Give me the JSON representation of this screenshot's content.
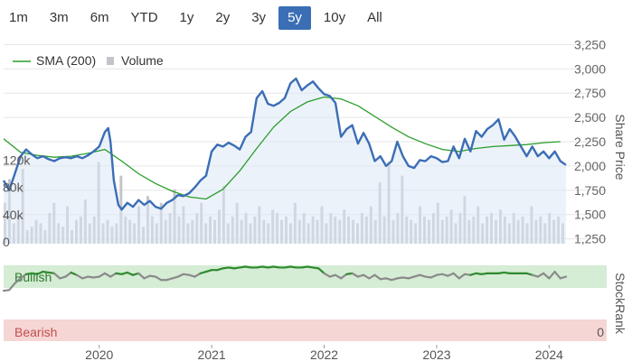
{
  "range_buttons": [
    "1m",
    "3m",
    "6m",
    "YTD",
    "1y",
    "2y",
    "3y",
    "5y",
    "10y",
    "All"
  ],
  "active_range": "5y",
  "colors": {
    "price_line": "#3b6eb5",
    "sma_line": "#2a9d2a",
    "volume_bar": "#c4c4c8",
    "stockrank_line_high": "#2f8a2f",
    "stockrank_line_low": "#8a8a8a",
    "bullish_band": "#d5ecd5",
    "bearish_band": "#f6d5d5",
    "active_button": "#3b6eb5"
  },
  "chart_data": [
    {
      "type": "line",
      "legend": [
        "SMA (200)",
        "Volume"
      ],
      "y_right_label": "Share Price",
      "y_right_ticks": [
        1250,
        1500,
        1750,
        2000,
        2250,
        2500,
        2750,
        3000,
        3250
      ],
      "y_right_tick_labels": [
        "1,250",
        "1,500",
        "1,750",
        "2,000",
        "2,250",
        "2,500",
        "2,750",
        "3,000",
        "3,250"
      ],
      "ylim": [
        1200,
        3300
      ],
      "volume_ticks_labels": [
        "0",
        "40k",
        "80k",
        "120k"
      ],
      "volume_ticks": [
        0,
        40,
        80,
        120
      ],
      "volume_ylim": [
        0,
        300
      ],
      "x_ticks": [
        "2020",
        "2021",
        "2022",
        "2023",
        "2024"
      ],
      "x_tick_values": [
        2020,
        2021,
        2022,
        2023,
        2024
      ],
      "xlim": [
        2019.15,
        2024.15
      ],
      "series": [
        {
          "name": "Share Price",
          "x": [
            2019.15,
            2019.2,
            2019.25,
            2019.3,
            2019.35,
            2019.4,
            2019.45,
            2019.5,
            2019.55,
            2019.6,
            2019.65,
            2019.7,
            2019.75,
            2019.8,
            2019.85,
            2019.9,
            2019.95,
            2020.0,
            2020.05,
            2020.08,
            2020.1,
            2020.13,
            2020.17,
            2020.2,
            2020.25,
            2020.3,
            2020.35,
            2020.4,
            2020.45,
            2020.5,
            2020.55,
            2020.6,
            2020.65,
            2020.7,
            2020.75,
            2020.8,
            2020.85,
            2020.9,
            2020.95,
            2021.0,
            2021.05,
            2021.1,
            2021.15,
            2021.2,
            2021.25,
            2021.3,
            2021.35,
            2021.4,
            2021.45,
            2021.5,
            2021.55,
            2021.6,
            2021.65,
            2021.7,
            2021.75,
            2021.8,
            2021.85,
            2021.9,
            2021.95,
            2022.0,
            2022.05,
            2022.1,
            2022.15,
            2022.2,
            2022.25,
            2022.3,
            2022.35,
            2022.4,
            2022.45,
            2022.5,
            2022.55,
            2022.6,
            2022.65,
            2022.7,
            2022.75,
            2022.8,
            2022.85,
            2022.9,
            2022.95,
            2023.0,
            2023.05,
            2023.1,
            2023.15,
            2023.2,
            2023.25,
            2023.3,
            2023.35,
            2023.4,
            2023.45,
            2023.5,
            2023.55,
            2023.6,
            2023.65,
            2023.7,
            2023.75,
            2023.8,
            2023.85,
            2023.9,
            2023.95,
            2024.0,
            2024.05,
            2024.1,
            2024.15
          ],
          "values": [
            1850,
            1750,
            1920,
            2100,
            2170,
            2120,
            2080,
            2100,
            2070,
            2050,
            2080,
            2090,
            2080,
            2100,
            2080,
            2110,
            2150,
            2200,
            2350,
            2390,
            2250,
            1850,
            1600,
            1550,
            1620,
            1580,
            1650,
            1600,
            1640,
            1580,
            1560,
            1620,
            1650,
            1700,
            1690,
            1720,
            1780,
            1850,
            1900,
            2150,
            2220,
            2200,
            2240,
            2210,
            2170,
            2300,
            2350,
            2700,
            2770,
            2640,
            2620,
            2650,
            2700,
            2850,
            2900,
            2780,
            2830,
            2870,
            2800,
            2740,
            2720,
            2650,
            2300,
            2380,
            2420,
            2230,
            2340,
            2230,
            2050,
            2100,
            2000,
            2050,
            2250,
            2100,
            2000,
            1980,
            2060,
            2050,
            2100,
            2080,
            2040,
            2050,
            2200,
            2080,
            2280,
            2150,
            2360,
            2300,
            2380,
            2420,
            2480,
            2270,
            2380,
            2300,
            2200,
            2100,
            2200,
            2100,
            2150,
            2080,
            2150,
            2050,
            2010
          ]
        },
        {
          "name": "SMA (200)",
          "x": [
            2019.15,
            2019.3,
            2019.45,
            2019.6,
            2019.75,
            2019.9,
            2020.05,
            2020.2,
            2020.35,
            2020.5,
            2020.65,
            2020.8,
            2020.95,
            2021.1,
            2021.25,
            2021.4,
            2021.55,
            2021.7,
            2021.85,
            2022.0,
            2022.15,
            2022.3,
            2022.45,
            2022.6,
            2022.75,
            2022.9,
            2023.05,
            2023.2,
            2023.35,
            2023.5,
            2023.65,
            2023.8,
            2023.95,
            2024.1
          ],
          "values": [
            2280,
            2140,
            2110,
            2090,
            2100,
            2130,
            2170,
            2050,
            1920,
            1820,
            1740,
            1680,
            1660,
            1760,
            1950,
            2180,
            2400,
            2560,
            2660,
            2710,
            2690,
            2620,
            2510,
            2400,
            2300,
            2230,
            2170,
            2150,
            2180,
            2200,
            2210,
            2220,
            2240,
            2250
          ]
        },
        {
          "name": "Volume",
          "values": [
            60,
            95,
            30,
            40,
            110,
            20,
            25,
            35,
            30,
            20,
            45,
            60,
            30,
            25,
            55,
            20,
            35,
            40,
            65,
            30,
            40,
            120,
            30,
            35,
            25,
            30,
            100,
            40,
            35,
            30,
            55,
            25,
            70,
            40,
            30,
            60,
            35,
            45,
            80,
            40,
            55,
            30,
            35,
            45,
            60,
            30,
            40,
            35,
            50,
            85,
            30,
            40,
            60,
            35,
            45,
            30,
            40,
            55,
            35,
            30,
            50,
            45,
            35,
            40,
            30,
            60,
            35,
            45,
            30,
            40,
            35,
            55,
            30,
            45,
            40,
            35,
            50,
            40,
            35,
            30,
            45,
            40,
            55,
            35,
            90,
            40,
            120,
            35,
            45,
            100,
            40,
            35,
            30,
            55,
            40,
            35,
            45,
            60,
            35,
            40,
            50,
            30,
            45,
            70,
            35,
            40,
            55,
            30,
            40,
            45,
            35,
            50,
            40,
            30,
            45,
            35,
            40,
            30,
            55,
            35,
            40,
            30,
            45,
            35,
            40,
            30
          ]
        }
      ]
    },
    {
      "type": "line",
      "y_right_label": "StockRank",
      "band_labels": [
        "Bullish",
        "Bearish"
      ],
      "band_right_value": "0",
      "ylim": [
        0,
        100
      ],
      "series": [
        {
          "name": "StockRank",
          "x": [
            2019.15,
            2019.2,
            2019.25,
            2019.3,
            2019.35,
            2019.4,
            2019.45,
            2019.5,
            2019.55,
            2019.6,
            2019.65,
            2019.7,
            2019.75,
            2019.8,
            2019.85,
            2019.9,
            2019.95,
            2020.0,
            2020.05,
            2020.1,
            2020.15,
            2020.2,
            2020.25,
            2020.3,
            2020.35,
            2020.4,
            2020.45,
            2020.5,
            2020.55,
            2020.6,
            2020.65,
            2020.7,
            2020.75,
            2020.8,
            2020.85,
            2020.9,
            2020.95,
            2021.0,
            2021.05,
            2021.1,
            2021.15,
            2021.2,
            2021.25,
            2021.3,
            2021.35,
            2021.4,
            2021.45,
            2021.5,
            2021.55,
            2021.6,
            2021.65,
            2021.7,
            2021.75,
            2021.8,
            2021.85,
            2021.9,
            2021.95,
            2022.0,
            2022.05,
            2022.1,
            2022.15,
            2022.2,
            2022.25,
            2022.3,
            2022.35,
            2022.4,
            2022.45,
            2022.5,
            2022.55,
            2022.6,
            2022.65,
            2022.7,
            2022.75,
            2022.8,
            2022.85,
            2022.9,
            2022.95,
            2023.0,
            2023.05,
            2023.1,
            2023.15,
            2023.2,
            2023.25,
            2023.3,
            2023.35,
            2023.4,
            2023.45,
            2023.5,
            2023.55,
            2023.6,
            2023.65,
            2023.7,
            2023.75,
            2023.8,
            2023.85,
            2023.9,
            2023.95,
            2024.0,
            2024.05,
            2024.1,
            2024.15
          ],
          "values": [
            65,
            66,
            74,
            80,
            85,
            86,
            85,
            88,
            87,
            86,
            80,
            82,
            87,
            84,
            80,
            82,
            81,
            82,
            86,
            82,
            86,
            85,
            87,
            84,
            86,
            80,
            83,
            82,
            78,
            78,
            80,
            82,
            85,
            84,
            82,
            86,
            88,
            90,
            90,
            92,
            93,
            92,
            93,
            94,
            93,
            93,
            94,
            93,
            94,
            93,
            93,
            94,
            93,
            93,
            94,
            93,
            92,
            86,
            82,
            84,
            80,
            85,
            86,
            82,
            84,
            80,
            84,
            79,
            80,
            78,
            80,
            81,
            80,
            82,
            84,
            82,
            81,
            84,
            85,
            83,
            86,
            80,
            85,
            84,
            86,
            85,
            86,
            86,
            86,
            87,
            86,
            86,
            86,
            86,
            84,
            82,
            86,
            80,
            88,
            80,
            82
          ]
        }
      ]
    }
  ]
}
